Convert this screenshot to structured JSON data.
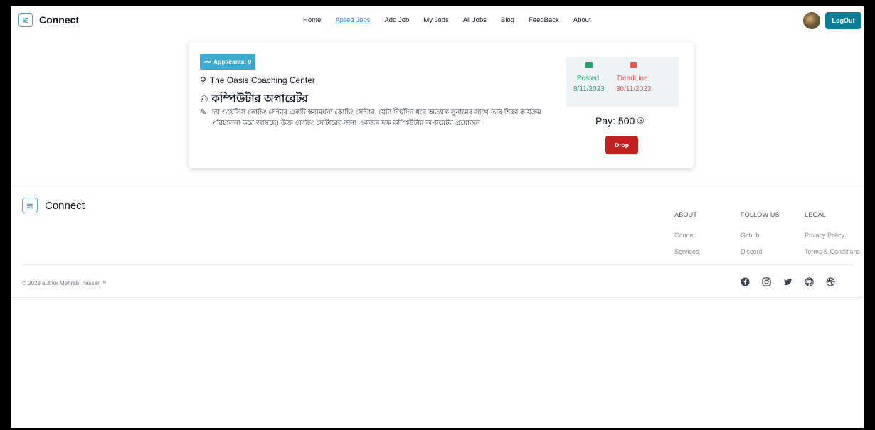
{
  "nav": {
    "brand": "Connect",
    "links": [
      "Home",
      "Aplied Jobs",
      "Add Job",
      "My Jobs",
      "All Jobs",
      "Blog",
      "FeedBack",
      "About"
    ],
    "logout_label": "LogOut"
  },
  "job": {
    "applicants_label": "Applicants: 0",
    "company": "The Oasis Coaching Center",
    "title": "কম্পিউটার অপারেটর",
    "description": "দ্যা ওয়েসিস কোচিং সেন্টার একটি স্বনামধন্য কোচিং সেন্টার, যেটা দীর্ঘদিন ধরে অত্যান্ত সুনামের সাথে তার শিক্ষা কার্যক্রম পরিচালনা করে আসছে। উক্ত কোচিং সেন্টারের জন্য একজন দক্ষ কম্পিউটার অপারেটর প্রয়োজন।",
    "posted_label": "Posted:",
    "posted_date": "8/11/2023",
    "deadline_label": "DeadLine:",
    "deadline_date": "30/11/2023",
    "pay": "Pay: 500",
    "drop_label": "Drop"
  },
  "footer": {
    "brand": "Connect",
    "about": {
      "heading": "ABOUT",
      "links": [
        "Connet",
        "Services"
      ]
    },
    "follow": {
      "heading": "FOLLOW US",
      "links": [
        "Github",
        "Discord"
      ]
    },
    "legal": {
      "heading": "LEGAL",
      "links": [
        "Privacy Policy",
        "Terms & Conditions"
      ]
    },
    "copyright": "© 2023 author Mehrab_hassan™",
    "social_icons": [
      "facebook-icon",
      "instagram-icon",
      "twitter-icon",
      "github-icon",
      "dribbble-icon"
    ]
  },
  "colors": {
    "accent": "#0e7c95",
    "badge": "#3ea9cf",
    "posted": "#28a06b",
    "deadline": "#e05a54",
    "drop": "#c0201f",
    "active_link": "#3b82f6"
  }
}
